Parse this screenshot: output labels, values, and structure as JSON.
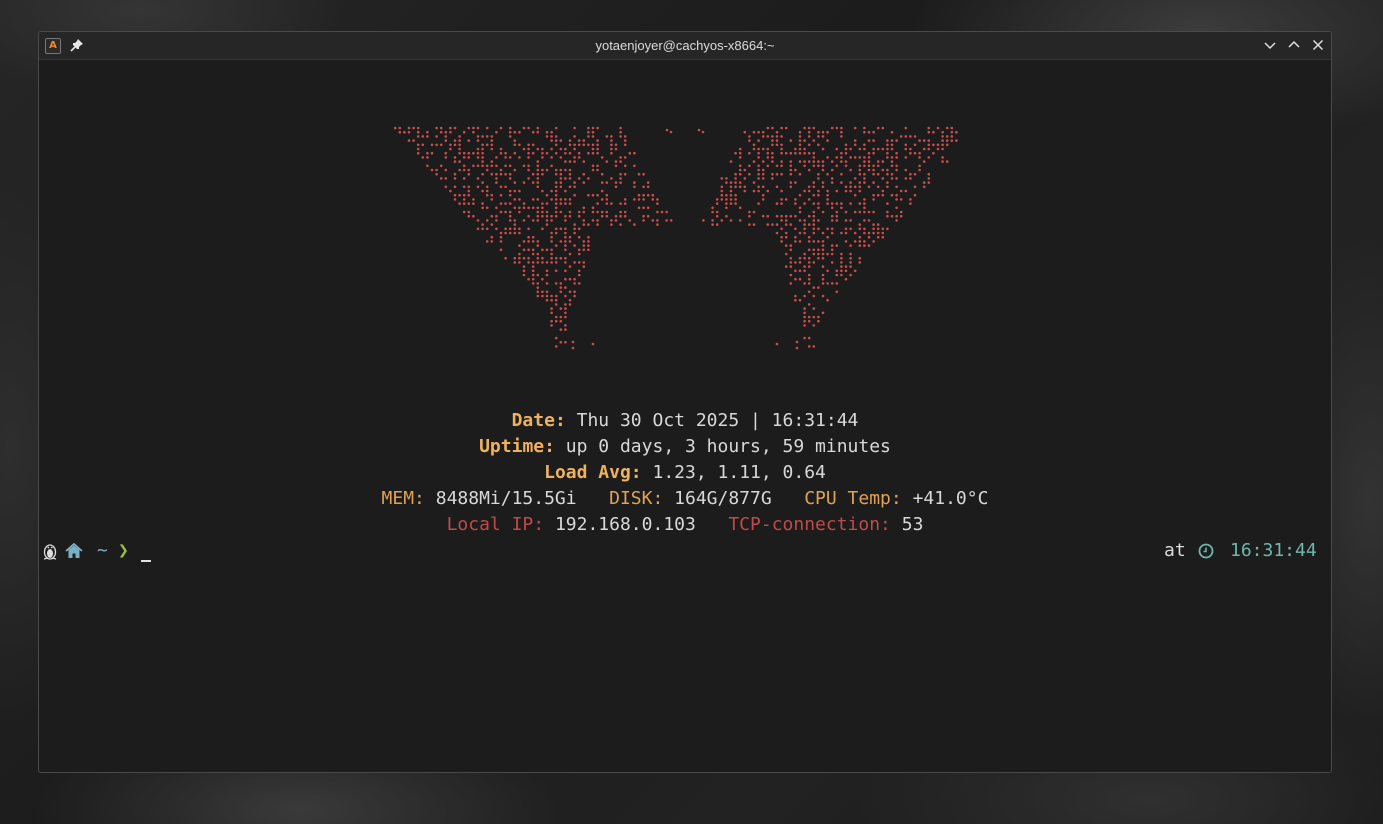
{
  "window": {
    "title": "yotaenjoyer@cachyos-x8664:~"
  },
  "icons": {
    "app": "alacritty-terminal-icon",
    "pin": "pin-icon",
    "minimize": "chevron-down-icon",
    "maximize": "chevron-up-icon",
    "close": "close-icon",
    "os": "linux-penguin-icon",
    "home": "home-icon",
    "clock": "clock-icon"
  },
  "colors": {
    "art": "#c94d4d",
    "label_gold": "#f0b15e",
    "label_red": "#c24a4a",
    "time": "#6fb7ad",
    "tilde": "#7ab0c4",
    "prompt_arrow": "#9bbf3a"
  },
  "fetch": {
    "date_label": "Date:",
    "date_value": " Thu 30 Oct 2025 | 16:31:44",
    "uptime_label": "Uptime:",
    "uptime_value": " up 0 days, 3 hours, 59 minutes",
    "load_label": "Load Avg:",
    "load_value": " 1.23, 1.11, 0.64",
    "mem_label": "MEM:",
    "mem_value": " 8488Mi/15.5Gi   ",
    "disk_label": "DISK:",
    "disk_value": " 164G/877G   ",
    "cpu_label": "CPU Temp:",
    "cpu_value": " +41.0°C",
    "ip_label": "Local IP:",
    "ip_value": " 192.168.0.103   ",
    "tcp_label": "TCP-connection:",
    "tcp_value": " 53"
  },
  "prompt": {
    "dir": "~",
    "arrow": "❯",
    "right_prefix": "at",
    "time": "16:31:44"
  }
}
